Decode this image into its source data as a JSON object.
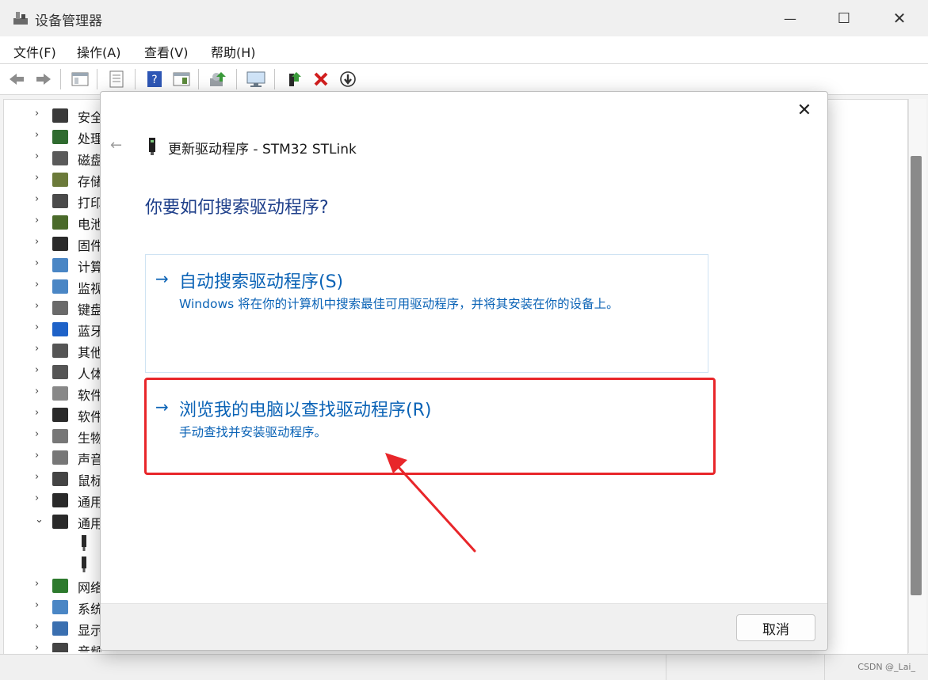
{
  "window": {
    "title": "设备管理器",
    "controls": {
      "minimize": "—",
      "maximize": "☐",
      "close": "✕"
    }
  },
  "menu": {
    "items": [
      {
        "label": "文件(F)"
      },
      {
        "label": "操作(A)"
      },
      {
        "label": "查看(V)"
      },
      {
        "label": "帮助(H)"
      }
    ]
  },
  "toolbar": {
    "buttons": [
      "back-icon",
      "forward-icon",
      "show-hide-tree-icon",
      "properties-icon",
      "help-icon",
      "view-icon",
      "scan-hardware-icon",
      "update-driver-icon",
      "enable-device-icon",
      "uninstall-icon",
      "disable-icon"
    ]
  },
  "tree": {
    "items": [
      {
        "label": "安全",
        "expanded": false
      },
      {
        "label": "处理",
        "expanded": false
      },
      {
        "label": "磁盘",
        "expanded": false
      },
      {
        "label": "存储",
        "expanded": false
      },
      {
        "label": "打印",
        "expanded": false
      },
      {
        "label": "电池",
        "expanded": false
      },
      {
        "label": "固件",
        "expanded": false
      },
      {
        "label": "计算",
        "expanded": false
      },
      {
        "label": "监视",
        "expanded": false
      },
      {
        "label": "键盘",
        "expanded": false
      },
      {
        "label": "蓝牙",
        "expanded": false
      },
      {
        "label": "其他",
        "expanded": false
      },
      {
        "label": "人体",
        "expanded": false
      },
      {
        "label": "软件",
        "expanded": false
      },
      {
        "label": "软件",
        "expanded": false
      },
      {
        "label": "生物",
        "expanded": false
      },
      {
        "label": "声音",
        "expanded": false
      },
      {
        "label": "鼠标",
        "expanded": false
      },
      {
        "label": "通用",
        "expanded": false
      },
      {
        "label": "通用",
        "expanded": true
      },
      {
        "label": "网络",
        "expanded": false
      },
      {
        "label": "系统",
        "expanded": false
      },
      {
        "label": "显示",
        "expanded": false
      },
      {
        "label": "音频",
        "expanded": false
      }
    ],
    "chevron_collapsed": "›",
    "chevron_expanded": "⌄"
  },
  "dialog": {
    "close": "✕",
    "back": "←",
    "title": "更新驱动程序 - STM32 STLink",
    "question": "你要如何搜索驱动程序?",
    "options": [
      {
        "arrow": "→",
        "title": "自动搜索驱动程序(S)",
        "desc": "Windows 将在你的计算机中搜索最佳可用驱动程序，并将其安装在你的设备上。"
      },
      {
        "arrow": "→",
        "title": "浏览我的电脑以查找驱动程序(R)",
        "desc": "手动查找并安装驱动程序。"
      }
    ],
    "cancel": "取消"
  },
  "watermark": "CSDN @_Lai_",
  "colors": {
    "link_blue": "#0b63b6",
    "heading_blue": "#1e3f8a",
    "annotation_red": "#e8262a"
  }
}
